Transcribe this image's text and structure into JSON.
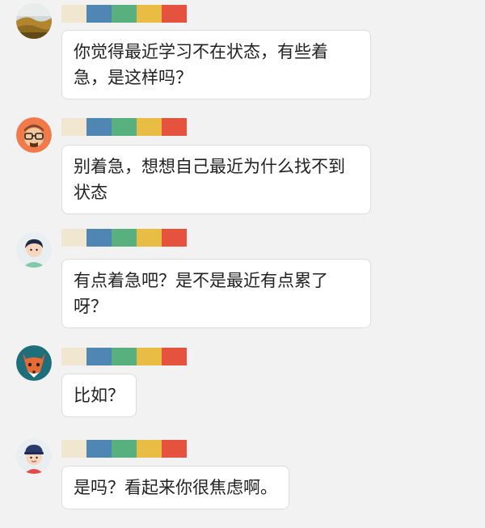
{
  "name_bar_colors": [
    "#f1e6cf",
    "#4f86b3",
    "#58b07f",
    "#e9bd43",
    "#e5523d"
  ],
  "messages": [
    {
      "avatar": "landscape-avatar",
      "text": "你觉得最近学习不在状态，有些着急，是这样吗？"
    },
    {
      "avatar": "glasses-man-avatar",
      "text": "别着急，想想自己最近为什么找不到状态"
    },
    {
      "avatar": "boy-avatar",
      "text": "有点着急吧？是不是最近有点累了呀？"
    },
    {
      "avatar": "fox-avatar",
      "text": "比如？"
    },
    {
      "avatar": "hat-boy-avatar",
      "text": "是吗？看起来你很焦虑啊。"
    }
  ]
}
